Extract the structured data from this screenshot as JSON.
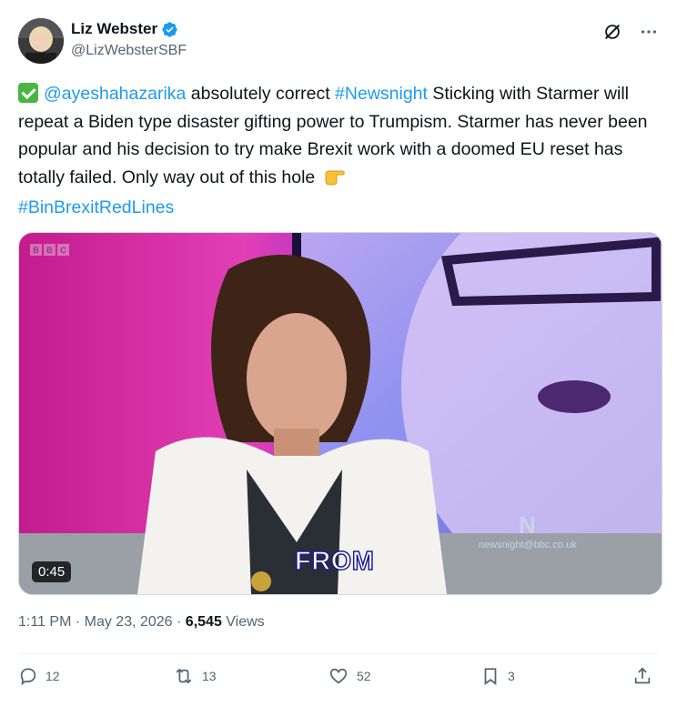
{
  "author": {
    "display_name": "Liz Webster",
    "handle": "@LizWebsterSBF"
  },
  "tweet": {
    "mention": "@ayeshahazarika",
    "text_1": " absolutely correct ",
    "hashtag_1": "#Newsnight",
    "text_2": "  Sticking with Starmer will repeat a Biden type disaster gifting power to Trumpism. Starmer has never been popular and his decision to try make Brexit work with a doomed EU reset has totally failed. Only way out of this hole ",
    "hashtag_2": "#BinBrexitRedLines"
  },
  "media": {
    "duration": "0:45",
    "caption": "FROM",
    "bbc_letters": [
      "B",
      "B",
      "C"
    ],
    "watermark_logo": "N",
    "watermark_url": "newsnight@bbc.co.uk"
  },
  "meta": {
    "time": "1:11 PM · May 23, 2026 · ",
    "views_count": "6,545",
    "views_label": " Views"
  },
  "actions": {
    "replies": "12",
    "reposts": "13",
    "likes": "52",
    "bookmarks": "3"
  },
  "colors": {
    "link": "#1d9bf0",
    "verified": "#1d9bf0",
    "text_secondary": "#536471"
  }
}
